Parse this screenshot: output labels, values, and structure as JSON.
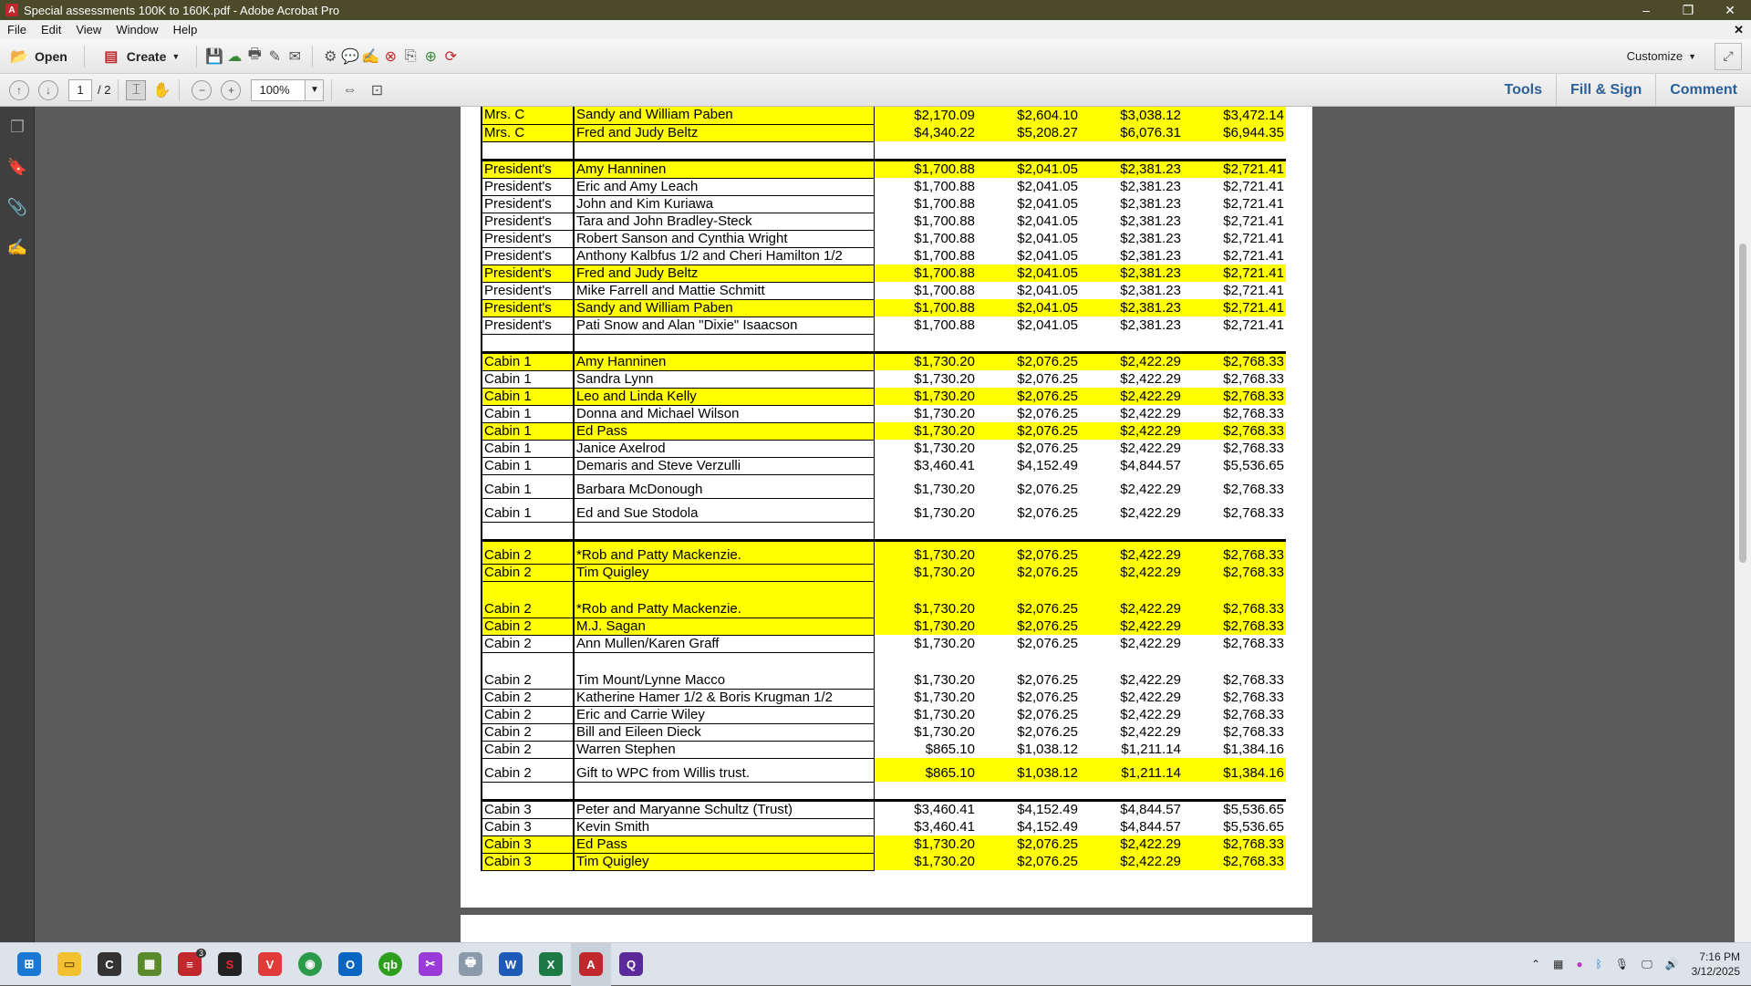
{
  "window": {
    "title": "Special assessments 100K to 160K.pdf - Adobe Acrobat Pro",
    "min": "–",
    "max": "❐",
    "close": "✕"
  },
  "menu": [
    "File",
    "Edit",
    "View",
    "Window",
    "Help"
  ],
  "toolbar": {
    "open": "Open",
    "create": "Create",
    "customize": "Customize"
  },
  "nav": {
    "page": "1",
    "total": "/ 2",
    "zoom": "100%"
  },
  "panels": {
    "tools": "Tools",
    "fill_sign": "Fill & Sign",
    "comment": "Comment"
  },
  "rows": [
    {
      "a": "Mrs. C",
      "b": "Sandy and William Paben",
      "v": [
        "$2,170.09",
        "$2,604.10",
        "$3,038.12",
        "$3,472.14"
      ],
      "hl": true
    },
    {
      "a": "Mrs. C",
      "b": "Fred and Judy Beltz",
      "v": [
        "$4,340.22",
        "$5,208.27",
        "$6,076.31",
        "$6,944.35"
      ],
      "hl": true
    },
    {
      "a": "",
      "b": "",
      "v": [
        "",
        "",
        "",
        ""
      ],
      "hl": false,
      "blank": true
    },
    {
      "a": "President's",
      "b": "Amy Hanninen",
      "v": [
        "$1,700.88",
        "$2,041.05",
        "$2,381.23",
        "$2,721.41"
      ],
      "hl": true,
      "thick": true
    },
    {
      "a": "President's",
      "b": "Eric and Amy Leach",
      "v": [
        "$1,700.88",
        "$2,041.05",
        "$2,381.23",
        "$2,721.41"
      ],
      "hl": false
    },
    {
      "a": "President's",
      "b": "John and Kim Kuriawa",
      "v": [
        "$1,700.88",
        "$2,041.05",
        "$2,381.23",
        "$2,721.41"
      ],
      "hl": false
    },
    {
      "a": "President's",
      "b": "Tara and John Bradley-Steck",
      "v": [
        "$1,700.88",
        "$2,041.05",
        "$2,381.23",
        "$2,721.41"
      ],
      "hl": false
    },
    {
      "a": "President's",
      "b": "Robert Sanson and Cynthia Wright",
      "v": [
        "$1,700.88",
        "$2,041.05",
        "$2,381.23",
        "$2,721.41"
      ],
      "hl": false
    },
    {
      "a": "President's",
      "b": "Anthony Kalbfus  1/2 and Cheri Hamilton 1/2",
      "v": [
        "$1,700.88",
        "$2,041.05",
        "$2,381.23",
        "$2,721.41"
      ],
      "hl": false
    },
    {
      "a": "President's",
      "b": "Fred and Judy Beltz",
      "v": [
        "$1,700.88",
        "$2,041.05",
        "$2,381.23",
        "$2,721.41"
      ],
      "hl": true
    },
    {
      "a": "President's",
      "b": "Mike Farrell and Mattie Schmitt",
      "v": [
        "$1,700.88",
        "$2,041.05",
        "$2,381.23",
        "$2,721.41"
      ],
      "hl": false
    },
    {
      "a": "President's",
      "b": "Sandy and William Paben",
      "v": [
        "$1,700.88",
        "$2,041.05",
        "$2,381.23",
        "$2,721.41"
      ],
      "hl": true
    },
    {
      "a": "President's",
      "b": "Pati Snow and Alan \"Dixie\" Isaacson",
      "v": [
        "$1,700.88",
        "$2,041.05",
        "$2,381.23",
        "$2,721.41"
      ],
      "hl": false
    },
    {
      "a": "",
      "b": "",
      "v": [
        "",
        "",
        "",
        ""
      ],
      "hl": false,
      "blank": true
    },
    {
      "a": "Cabin 1",
      "b": "Amy Hanninen",
      "v": [
        "$1,730.20",
        "$2,076.25",
        "$2,422.29",
        "$2,768.33"
      ],
      "hl": true,
      "thick": true
    },
    {
      "a": "Cabin 1",
      "b": "Sandra Lynn",
      "v": [
        "$1,730.20",
        "$2,076.25",
        "$2,422.29",
        "$2,768.33"
      ],
      "hl": false
    },
    {
      "a": "Cabin 1",
      "b": "Leo and Linda Kelly",
      "v": [
        "$1,730.20",
        "$2,076.25",
        "$2,422.29",
        "$2,768.33"
      ],
      "hl": true
    },
    {
      "a": "Cabin 1",
      "b": "Donna and Michael Wilson",
      "v": [
        "$1,730.20",
        "$2,076.25",
        "$2,422.29",
        "$2,768.33"
      ],
      "hl": false
    },
    {
      "a": "Cabin 1",
      "b": "Ed Pass",
      "v": [
        "$1,730.20",
        "$2,076.25",
        "$2,422.29",
        "$2,768.33"
      ],
      "hl": true
    },
    {
      "a": "Cabin 1",
      "b": "Janice Axelrod",
      "v": [
        "$1,730.20",
        "$2,076.25",
        "$2,422.29",
        "$2,768.33"
      ],
      "hl": false
    },
    {
      "a": "Cabin 1",
      "b": "Demaris and Steve Verzulli",
      "v": [
        "$3,460.41",
        "$4,152.49",
        "$4,844.57",
        "$5,536.65"
      ],
      "hl": false
    },
    {
      "a": "Cabin 1",
      "b": "Barbara McDonough",
      "v": [
        "$1,730.20",
        "$2,076.25",
        "$2,422.29",
        "$2,768.33"
      ],
      "hl": false,
      "tall": true
    },
    {
      "a": "Cabin 1",
      "b": "Ed and Sue Stodola",
      "v": [
        "$1,730.20",
        "$2,076.25",
        "$2,422.29",
        "$2,768.33"
      ],
      "hl": false,
      "tall": true
    },
    {
      "a": "",
      "b": "",
      "v": [
        "",
        "",
        "",
        ""
      ],
      "hl": false,
      "blank": true
    },
    {
      "a": "Cabin 2",
      "b": "*Rob and Patty Mackenzie.",
      "v": [
        "$1,730.20",
        "$2,076.25",
        "$2,422.29",
        "$2,768.33"
      ],
      "hl": true,
      "thick": true,
      "tall": true
    },
    {
      "a": "Cabin 2",
      "b": "Tim Quigley",
      "v": [
        "$1,730.20",
        "$2,076.25",
        "$2,422.29",
        "$2,768.33"
      ],
      "hl": true
    },
    {
      "a": "Cabin 2",
      "b": "*Rob and Patty Mackenzie.",
      "v": [
        "$1,730.20",
        "$2,076.25",
        "$2,422.29",
        "$2,768.33"
      ],
      "hl": true,
      "taller": true
    },
    {
      "a": "Cabin 2",
      "b": "M.J. Sagan",
      "v": [
        "$1,730.20",
        "$2,076.25",
        "$2,422.29",
        "$2,768.33"
      ],
      "hl": true
    },
    {
      "a": "Cabin 2",
      "b": "Ann Mullen/Karen Graff",
      "v": [
        "$1,730.20",
        "$2,076.25",
        "$2,422.29",
        "$2,768.33"
      ],
      "hl": false
    },
    {
      "a": "Cabin 2",
      "b": "Tim Mount/Lynne Macco",
      "v": [
        "$1,730.20",
        "$2,076.25",
        "$2,422.29",
        "$2,768.33"
      ],
      "hl": false,
      "taller": true
    },
    {
      "a": "Cabin 2",
      "b": "Katherine Hamer 1/2 & Boris Krugman 1/2",
      "v": [
        "$1,730.20",
        "$2,076.25",
        "$2,422.29",
        "$2,768.33"
      ],
      "hl": false
    },
    {
      "a": "Cabin 2",
      "b": "Eric and Carrie Wiley",
      "v": [
        "$1,730.20",
        "$2,076.25",
        "$2,422.29",
        "$2,768.33"
      ],
      "hl": false
    },
    {
      "a": "Cabin 2",
      "b": "Bill and Eileen Dieck",
      "v": [
        "$1,730.20",
        "$2,076.25",
        "$2,422.29",
        "$2,768.33"
      ],
      "hl": false
    },
    {
      "a": "Cabin 2",
      "b": "Warren Stephen",
      "v": [
        "$865.10",
        "$1,038.12",
        "$1,211.14",
        "$1,384.16"
      ],
      "hl": false
    },
    {
      "a": "Cabin 2",
      "b": "Gift to WPC from Willis trust.",
      "v": [
        "$865.10",
        "$1,038.12",
        "$1,211.14",
        "$1,384.16"
      ],
      "hl": false,
      "numhl": true,
      "tall": true
    },
    {
      "a": "",
      "b": "",
      "v": [
        "",
        "",
        "",
        ""
      ],
      "hl": false,
      "blank": true
    },
    {
      "a": "Cabin 3",
      "b": "Peter and Maryanne Schultz (Trust)",
      "v": [
        "$3,460.41",
        "$4,152.49",
        "$4,844.57",
        "$5,536.65"
      ],
      "hl": false,
      "thick": true
    },
    {
      "a": "Cabin 3",
      "b": "Kevin Smith",
      "v": [
        "$3,460.41",
        "$4,152.49",
        "$4,844.57",
        "$5,536.65"
      ],
      "hl": false
    },
    {
      "a": "Cabin 3",
      "b": "Ed Pass",
      "v": [
        "$1,730.20",
        "$2,076.25",
        "$2,422.29",
        "$2,768.33"
      ],
      "hl": true
    },
    {
      "a": "Cabin 3",
      "b": "Tim Quigley",
      "v": [
        "$1,730.20",
        "$2,076.25",
        "$2,422.29",
        "$2,768.33"
      ],
      "hl": true
    }
  ],
  "taskbar": {
    "badge": "3",
    "time": "7:16 PM",
    "date": "3/12/2025"
  }
}
